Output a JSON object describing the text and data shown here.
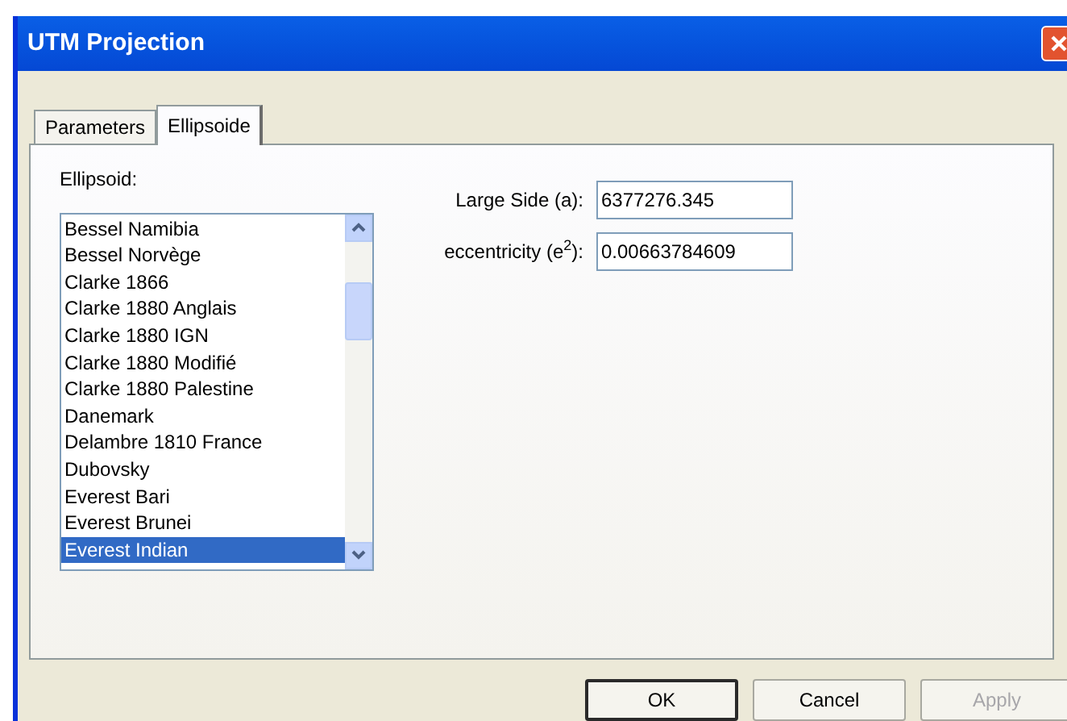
{
  "window": {
    "title": "UTM Projection"
  },
  "tabs": [
    {
      "label": "Parameters",
      "selected": false
    },
    {
      "label": "Ellipsoide",
      "selected": true
    }
  ],
  "ellipsoid": {
    "label": "Ellipsoid:",
    "items": [
      {
        "label": "Bessel Namibia",
        "selected": false
      },
      {
        "label": "Bessel Norvège",
        "selected": false
      },
      {
        "label": "Clarke 1866",
        "selected": false
      },
      {
        "label": "Clarke 1880 Anglais",
        "selected": false
      },
      {
        "label": "Clarke 1880 IGN",
        "selected": false
      },
      {
        "label": "Clarke 1880 Modifié",
        "selected": false
      },
      {
        "label": "Clarke 1880 Palestine",
        "selected": false
      },
      {
        "label": "Danemark",
        "selected": false
      },
      {
        "label": "Delambre 1810 France",
        "selected": false
      },
      {
        "label": "Dubovsky",
        "selected": false
      },
      {
        "label": "Everest Bari",
        "selected": false
      },
      {
        "label": "Everest Brunei",
        "selected": false
      },
      {
        "label": "Everest Indian",
        "selected": true
      }
    ]
  },
  "fields": [
    {
      "label": "Large Side (a):",
      "value": "6377276.345"
    },
    {
      "label": "eccentricity (e$^{2}$):",
      "value": "0.00663784609"
    }
  ],
  "buttons": [
    {
      "label": "OK",
      "default": true,
      "disabled": false
    },
    {
      "label": "Cancel",
      "default": false,
      "disabled": false
    },
    {
      "label": "Apply",
      "default": false,
      "disabled": true
    }
  ]
}
